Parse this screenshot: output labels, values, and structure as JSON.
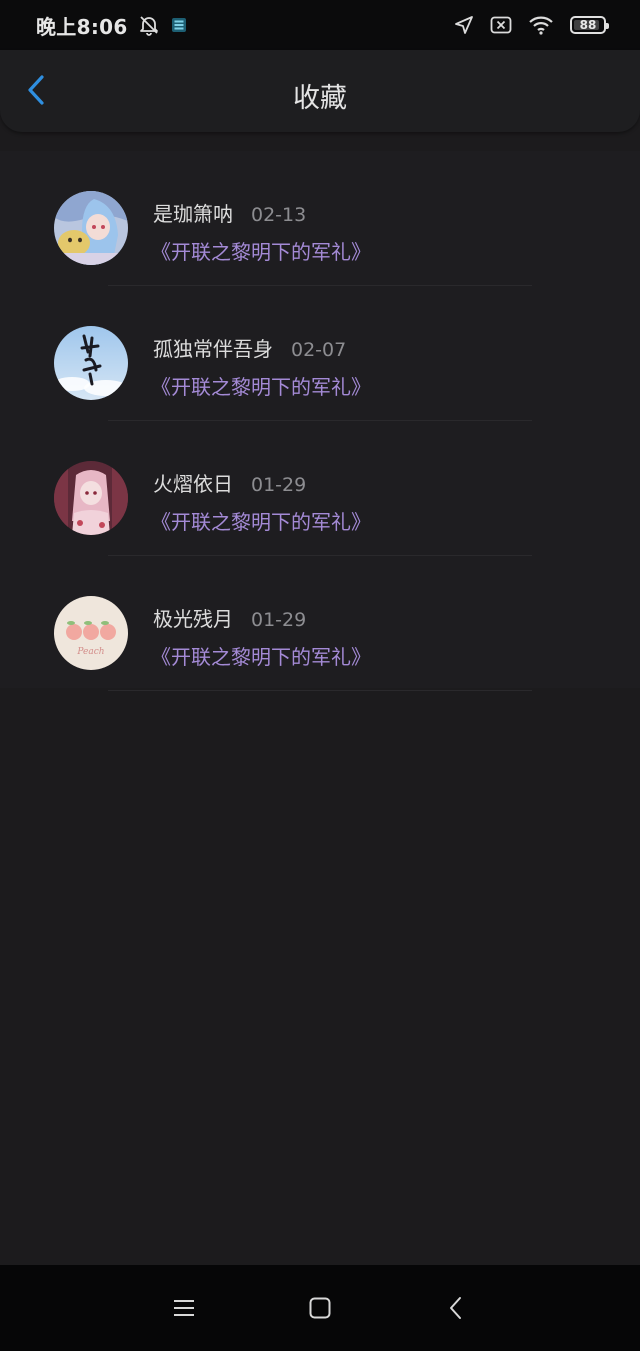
{
  "status_bar": {
    "time": "晚上8:06",
    "battery_level": "88",
    "icons": [
      "mute-bell-icon",
      "app-notification-icon",
      "location-arrow-icon",
      "no-sim-icon",
      "wifi-icon",
      "battery-icon"
    ]
  },
  "header": {
    "title": "收藏",
    "back_icon": "chevron-left-icon"
  },
  "favorites": [
    {
      "username": "是珈箫呐",
      "date": "02-13",
      "book": "《开联之黎明下的军礼》",
      "avatar": "anime-girl-avatar"
    },
    {
      "username": "孤独常伴吾身",
      "date": "02-07",
      "book": "《开联之黎明下的军礼》",
      "avatar": "calligraphy-sky-avatar"
    },
    {
      "username": "火熠依日",
      "date": "01-29",
      "book": "《开联之黎明下的军礼》",
      "avatar": "pink-anime-avatar"
    },
    {
      "username": "极光残月",
      "date": "01-29",
      "book": "《开联之黎明下的军礼》",
      "avatar": "peach-avatar"
    }
  ],
  "avatar_peach_text": "Peach",
  "nav_bar": {
    "icons": [
      "menu-icon",
      "home-icon",
      "back-icon"
    ]
  },
  "colors": {
    "accent_blue": "#2f8fe0",
    "link_purple": "#a48ad6",
    "background": "#1c1b1d"
  }
}
